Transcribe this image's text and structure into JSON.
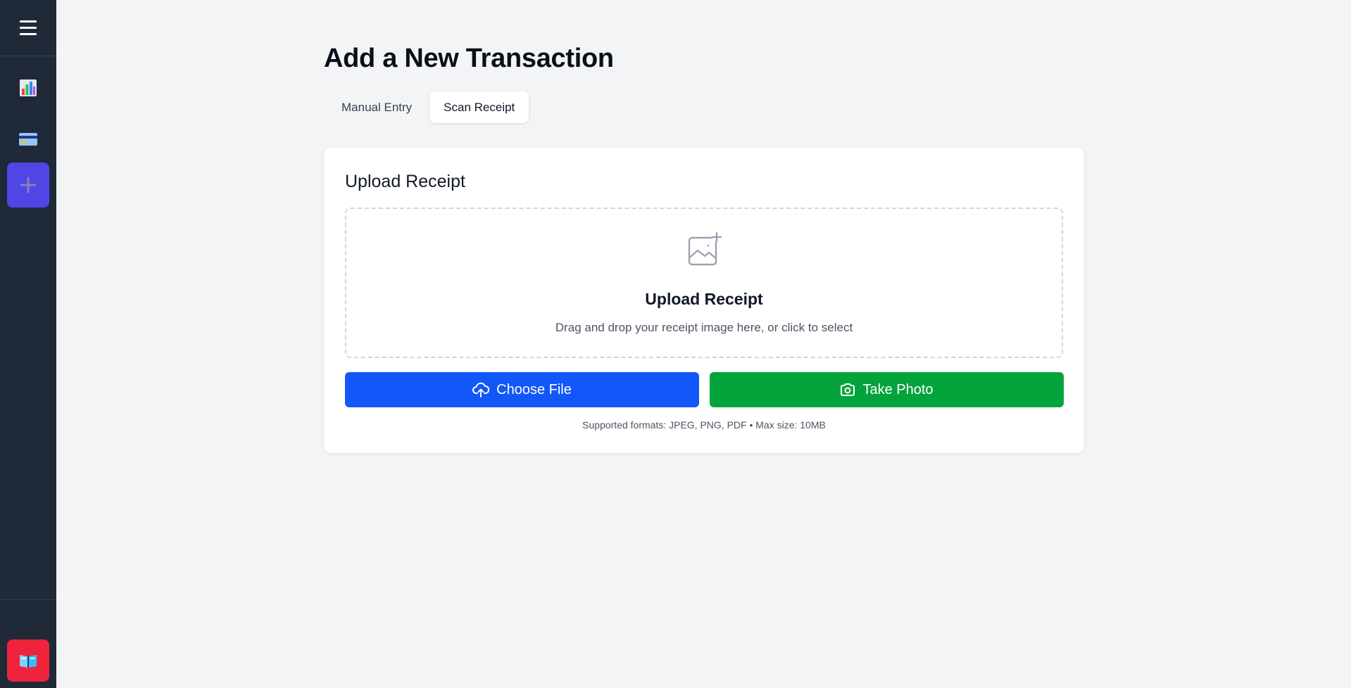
{
  "sidebar": {
    "menu_icon": "hamburger-icon",
    "items": [
      {
        "icon": "bar-chart-icon",
        "active": false
      },
      {
        "icon": "credit-card-icon",
        "active": false
      },
      {
        "icon": "plus-icon",
        "active": true
      }
    ],
    "bottom_icon": "book-icon"
  },
  "main": {
    "title": "Add a New Transaction",
    "tabs": [
      {
        "label": "Manual Entry",
        "active": false
      },
      {
        "label": "Scan Receipt",
        "active": true
      }
    ]
  },
  "upload": {
    "card_title": "Upload Receipt",
    "dropzone_title": "Upload Receipt",
    "dropzone_subtitle": "Drag and drop your receipt image here, or click to select",
    "choose_label": "Choose File",
    "photo_label": "Take Photo",
    "formats": "Supported formats: JPEG, PNG, PDF • Max size: 10MB"
  },
  "colors": {
    "sidebar_bg": "#1f2937",
    "active_nav": "#4f46e5",
    "choose_btn": "#1257fa",
    "photo_btn": "#03a43c",
    "bottom_btn": "#ef233c"
  }
}
